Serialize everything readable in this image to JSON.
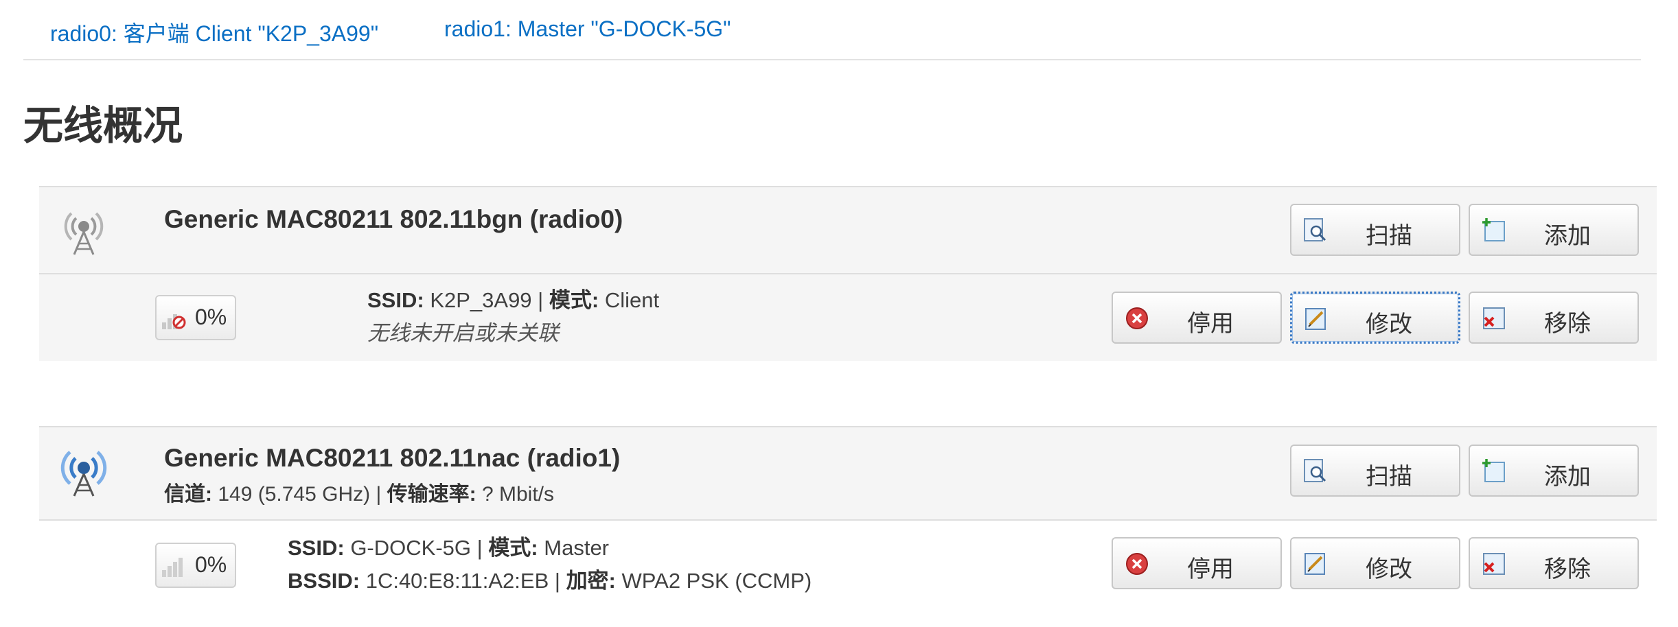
{
  "tabs": [
    {
      "label": "radio0: 客户端 Client \"K2P_3A99\""
    },
    {
      "label": "radio1: Master \"G-DOCK-5G\""
    }
  ],
  "page_title": "无线概况",
  "devices": [
    {
      "title": "Generic MAC80211 802.11bgn (radio0)",
      "buttons": {
        "scan": "扫描",
        "add": "添加"
      },
      "network": {
        "signal": "0%",
        "ssid_label": "SSID:",
        "ssid": "K2P_3A99",
        "sep": "|",
        "mode_label": "模式:",
        "mode": "Client",
        "status": "无线未开启或未关联",
        "buttons": {
          "disable": "停用",
          "edit": "修改",
          "remove": "移除"
        }
      }
    },
    {
      "title": "Generic MAC80211 802.11nac (radio1)",
      "channel_label": "信道:",
      "channel": "149 (5.745 GHz)",
      "sep": "|",
      "rate_label": "传输速率:",
      "rate": "? Mbit/s",
      "buttons": {
        "scan": "扫描",
        "add": "添加"
      },
      "network": {
        "signal": "0%",
        "ssid_label": "SSID:",
        "ssid": "G-DOCK-5G",
        "sep": "|",
        "mode_label": "模式:",
        "mode": "Master",
        "bssid_label": "BSSID:",
        "bssid": "1C:40:E8:11:A2:EB",
        "enc_label": "加密:",
        "enc": "WPA2 PSK (CCMP)",
        "buttons": {
          "disable": "停用",
          "edit": "修改",
          "remove": "移除"
        }
      }
    }
  ],
  "icons": {
    "radio": "wifi-radio-icon",
    "signal": "signal-strength-icon",
    "scan": "scan-icon",
    "add": "add-icon",
    "disable": "disable-icon",
    "edit": "edit-icon",
    "remove": "remove-icon"
  },
  "colors": {
    "link": "#0a6fc4",
    "row_bg": "#f5f5f5",
    "radio_inactive": "#9a9a9a",
    "radio_active": "#3a7cc8"
  }
}
